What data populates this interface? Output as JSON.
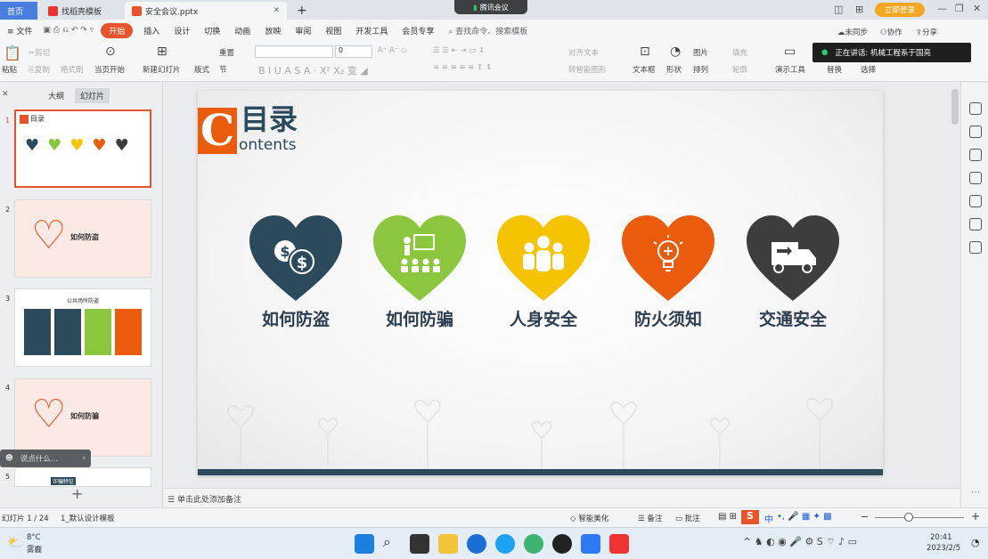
{
  "tabs": {
    "home": "首页",
    "template": "找稻壳模板",
    "doc": "安全会议.pptx",
    "plus": "+"
  },
  "meeting": {
    "label": "腾讯会议"
  },
  "window": {
    "login": "立即登录"
  },
  "menu": {
    "file": "文件",
    "items": [
      "开始",
      "插入",
      "设计",
      "切换",
      "动画",
      "放映",
      "审阅",
      "视图",
      "开发工具",
      "会员专享"
    ],
    "search": "查找命令、搜索模板",
    "sync": "未同步",
    "collab": "协作",
    "share": "分享"
  },
  "ribbon": {
    "paste": "粘贴",
    "cut": "剪切",
    "copy": "复制",
    "format": "格式刷",
    "play": "当页开始",
    "newslide": "新建幻灯片",
    "layout": "版式",
    "section": "节",
    "reset": "重置",
    "fontsize": "0",
    "align": "对齐文本",
    "smart": "转智能图形",
    "textbox": "文本框",
    "shape": "形状",
    "picture": "图片",
    "arrange": "排列",
    "fill": "填充",
    "outline": "轮廓",
    "present": "演示工具",
    "replace": "替换",
    "select": "选择",
    "speaking": "正在讲话: 机械工程系于国亮"
  },
  "leftpanel": {
    "outline": "大纲",
    "slides": "幻灯片",
    "thumbs": [
      "1",
      "2",
      "3",
      "4",
      "5"
    ],
    "add": "+",
    "chat": "说点什么...",
    "t1title": "目录",
    "t2title": "如何防盗",
    "t3title": "公共场所防盗",
    "t4title": "如何防骗",
    "t5title": "诈骗特征"
  },
  "slide": {
    "logo_letter": "C",
    "title": "目录",
    "subtitle": "ontents",
    "items": [
      {
        "label": "如何防盗",
        "color": "#2b4a5c",
        "icon": "money-icon"
      },
      {
        "label": "如何防骗",
        "color": "#8cc63f",
        "icon": "presentation-icon"
      },
      {
        "label": "人身安全",
        "color": "#f5c300",
        "icon": "group-icon"
      },
      {
        "label": "防火须知",
        "color": "#ea5b0c",
        "icon": "lightbulb-icon"
      },
      {
        "label": "交通安全",
        "color": "#3d3d3d",
        "icon": "truck-icon"
      }
    ]
  },
  "notes": {
    "placeholder": "单击此处添加备注"
  },
  "status": {
    "slide": "幻灯片 1 / 24",
    "template": "1_默认设计模板",
    "beautify": "智能美化",
    "notes": "备注",
    "comment": "批注",
    "ime": "中"
  },
  "taskbar": {
    "temp": "8°C",
    "weather": "雾霾",
    "time": "20:41",
    "date": "2023/2/5"
  }
}
